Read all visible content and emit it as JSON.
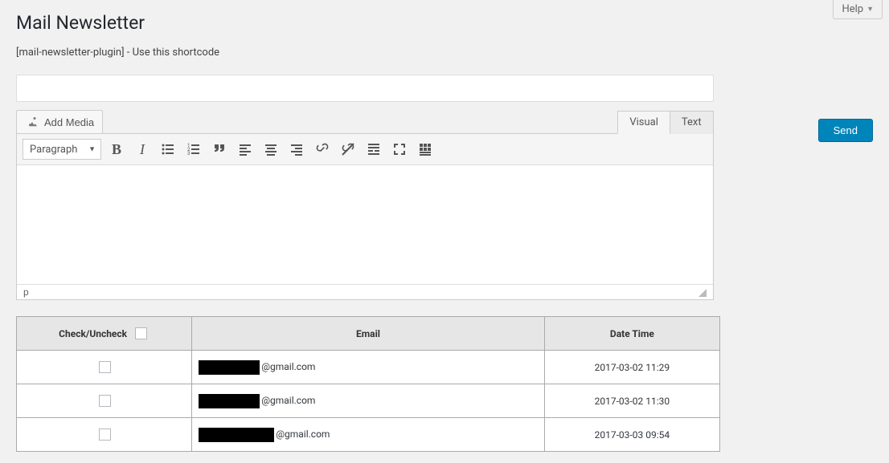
{
  "help": {
    "label": "Help"
  },
  "page": {
    "title": "Mail Newsletter"
  },
  "shortcode_note": "[mail-newsletter-plugin] - Use this shortcode",
  "editor": {
    "title_value": "",
    "add_media_label": "Add Media",
    "tab_visual": "Visual",
    "tab_text": "Text",
    "format_label": "Paragraph",
    "status_path": "p"
  },
  "send": {
    "label": "Send"
  },
  "table": {
    "headers": {
      "check": "Check/Uncheck",
      "email": "Email",
      "datetime": "Date Time"
    },
    "rows": [
      {
        "email_suffix": "@gmail.com",
        "datetime": "2017-03-02 11:29"
      },
      {
        "email_suffix": "@gmail.com",
        "datetime": "2017-03-02 11:30"
      },
      {
        "email_suffix": "@gmail.com",
        "datetime": "2017-03-03 09:54"
      }
    ]
  }
}
